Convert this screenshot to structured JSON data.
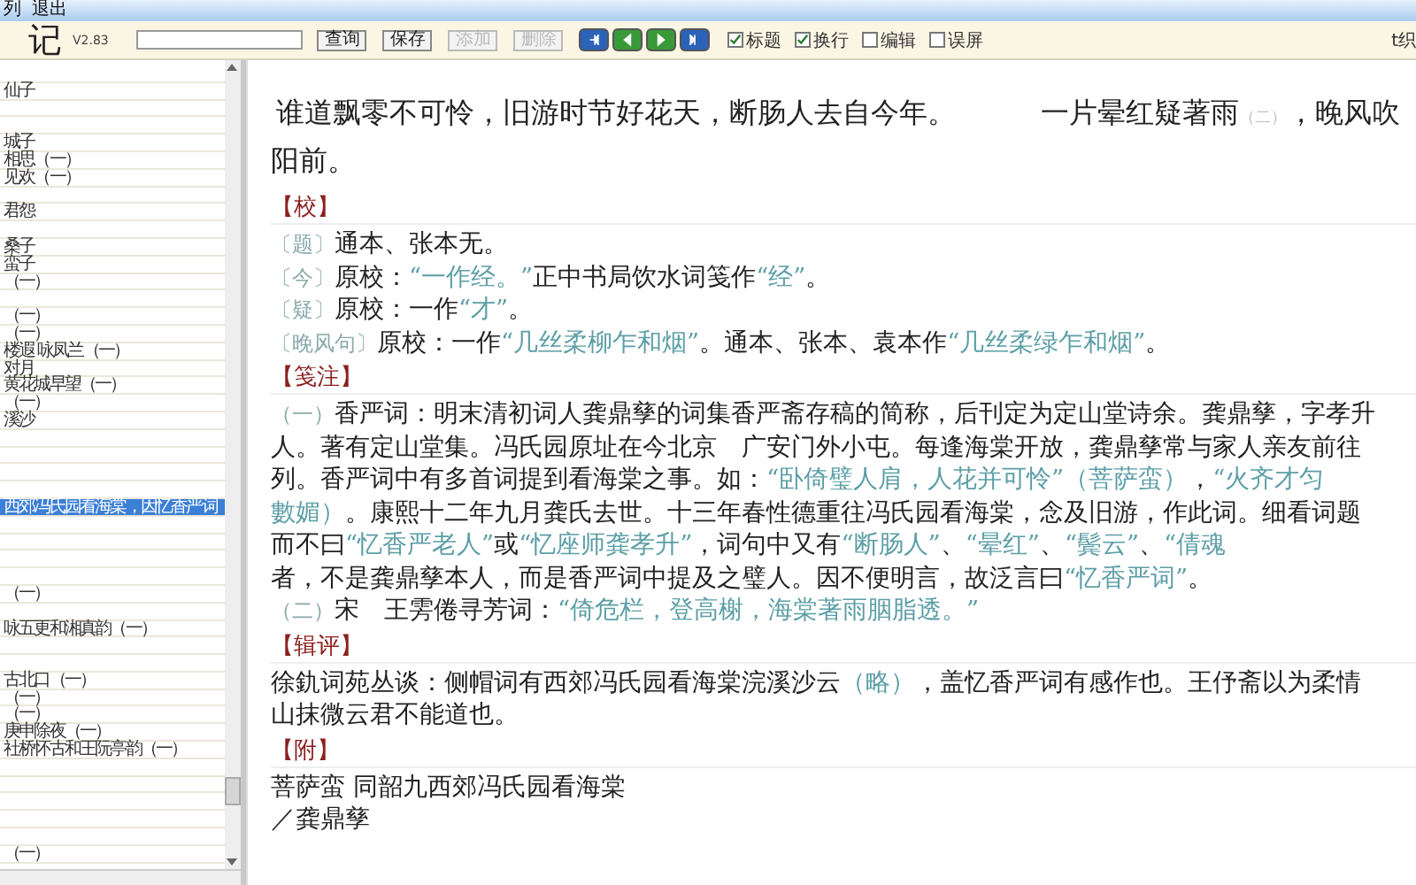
{
  "menu": [
    {
      "label": "列"
    },
    {
      "label": "退出"
    }
  ],
  "toolbar": {
    "logo": "记",
    "version": "V2.83",
    "buttons": [
      {
        "label": "查询",
        "disabled": false
      },
      {
        "label": "保存",
        "disabled": false
      },
      {
        "label": "添加",
        "disabled": true
      },
      {
        "label": "删除",
        "disabled": true
      }
    ],
    "nav_buttons": [
      {
        "kind": "first"
      },
      {
        "kind": "previous"
      },
      {
        "kind": "next"
      },
      {
        "kind": "last"
      }
    ],
    "checkboxes": [
      {
        "label": "标题",
        "checked": true
      },
      {
        "label": "换行",
        "checked": true
      },
      {
        "label": "编辑",
        "checked": false
      },
      {
        "label": "误屏",
        "checked": false
      }
    ],
    "corner_text": "t织"
  },
  "sidebar": {
    "items": [
      {
        "kind": "blank"
      },
      {
        "kind": "entry",
        "label": "仙子",
        "selected": false
      },
      {
        "kind": "blank"
      },
      {
        "kind": "blank"
      },
      {
        "kind": "entry",
        "label": "城子",
        "selected": false
      },
      {
        "kind": "entry",
        "label": "相思（一）",
        "selected": false
      },
      {
        "kind": "entry",
        "label": "见欢（一）",
        "selected": false
      },
      {
        "kind": "blank"
      },
      {
        "kind": "entry",
        "label": "君怨",
        "selected": false
      },
      {
        "kind": "blank"
      },
      {
        "kind": "entry",
        "label": "桑子",
        "selected": false
      },
      {
        "kind": "entry",
        "label": "蛮子",
        "selected": false
      },
      {
        "kind": "entry",
        "label": "（一）",
        "selected": false
      },
      {
        "kind": "blank"
      },
      {
        "kind": "entry",
        "label": "（一）",
        "selected": false
      },
      {
        "kind": "entry",
        "label": "（一）",
        "selected": false
      },
      {
        "kind": "entry",
        "label": "楼遐 咏凤兰（一）",
        "selected": false
      },
      {
        "kind": "entry",
        "label": "对月",
        "selected": false
      },
      {
        "kind": "entry",
        "label": "黄花城早望（一）",
        "selected": false
      },
      {
        "kind": "entry",
        "label": "（一）",
        "selected": false
      },
      {
        "kind": "entry",
        "label": "溪沙",
        "selected": false
      },
      {
        "kind": "blank"
      },
      {
        "kind": "blank"
      },
      {
        "kind": "blank"
      },
      {
        "kind": "blank"
      },
      {
        "kind": "entry",
        "label": "西郊冯氏园看海棠，因忆香严词",
        "selected": true
      },
      {
        "kind": "blank"
      },
      {
        "kind": "blank"
      },
      {
        "kind": "blank"
      },
      {
        "kind": "blank"
      },
      {
        "kind": "entry",
        "label": "（一）",
        "selected": false
      },
      {
        "kind": "blank"
      },
      {
        "kind": "entry",
        "label": "咏五更和湘真韵（一）",
        "selected": false
      },
      {
        "kind": "blank"
      },
      {
        "kind": "blank"
      },
      {
        "kind": "entry",
        "label": "古北口（一）",
        "selected": false
      },
      {
        "kind": "entry",
        "label": "（一）",
        "selected": false
      },
      {
        "kind": "entry",
        "label": "（一）",
        "selected": false
      },
      {
        "kind": "entry",
        "label": "庚申除夜（一）",
        "selected": false
      },
      {
        "kind": "entry",
        "label": "社桥怀古和王阮亭韵（一）",
        "selected": false
      },
      {
        "kind": "blank"
      },
      {
        "kind": "blank"
      },
      {
        "kind": "blank"
      },
      {
        "kind": "blank"
      },
      {
        "kind": "blank"
      },
      {
        "kind": "entry",
        "label": "（一）",
        "selected": false
      }
    ]
  },
  "content": {
    "poem_lines": [
      [
        {
          "kind": "text",
          "text": "谁道飘零不可怜，旧游时节好花天，断肠人去自今年。　　　一片晕红疑著雨"
        },
        {
          "kind": "note",
          "text": "（二）"
        },
        {
          "kind": "text",
          "text": "，晚风吹"
        }
      ],
      [
        {
          "kind": "text",
          "text": "阳前。"
        }
      ]
    ],
    "sections": [
      {
        "heading": "【校】",
        "lines": [
          [
            {
              "kind": "mark",
              "text": "〔题〕"
            },
            {
              "kind": "text",
              "text": "通本、张本无。"
            }
          ],
          [
            {
              "kind": "mark",
              "text": "〔今〕"
            },
            {
              "kind": "text",
              "text": "原校："
            },
            {
              "kind": "quote",
              "text": "“一作经。”"
            },
            {
              "kind": "text",
              "text": "正中书局饮水词笺作"
            },
            {
              "kind": "quote",
              "text": "“经”"
            },
            {
              "kind": "text",
              "text": "。"
            }
          ],
          [
            {
              "kind": "mark",
              "text": "〔疑〕"
            },
            {
              "kind": "text",
              "text": "原校：一作"
            },
            {
              "kind": "quote",
              "text": "“才”"
            },
            {
              "kind": "text",
              "text": "。"
            }
          ],
          [
            {
              "kind": "mark",
              "text": "〔晚风句〕"
            },
            {
              "kind": "text",
              "text": "原校：一作"
            },
            {
              "kind": "quote",
              "text": "“几丝柔柳乍和烟”"
            },
            {
              "kind": "text",
              "text": "。通本、张本、袁本作"
            },
            {
              "kind": "quote",
              "text": "“几丝柔绿乍和烟”"
            },
            {
              "kind": "text",
              "text": "。"
            }
          ]
        ]
      },
      {
        "heading": "【笺注】",
        "lines": [
          [
            {
              "kind": "mark",
              "text": "（一）"
            },
            {
              "kind": "text",
              "text": "香严词：明末清初词人龚鼎孳的词集香严斋存稿的简称，后刊定为定山堂诗余。龚鼎孳，字孝升"
            }
          ],
          [
            {
              "kind": "text",
              "text": "人。著有定山堂集。冯氏园原址在今北京　广安门外小屯。每逢海棠开放，龚鼎孳常与家人亲友前往"
            }
          ],
          [
            {
              "kind": "text",
              "text": "列。香严词中有多首词提到看海棠之事。如："
            },
            {
              "kind": "quote",
              "text": "“卧倚璧人肩，人花并可怜”"
            },
            {
              "kind": "quote",
              "text": "（菩萨蛮）"
            },
            {
              "kind": "text",
              "text": "，"
            },
            {
              "kind": "quote",
              "text": "“火齐才匀"
            }
          ],
          [
            {
              "kind": "quote",
              "text": "數媚）"
            },
            {
              "kind": "text",
              "text": "。康熙十二年九月龚氏去世。十三年春性德重往冯氏园看海棠，念及旧游，作此词。细看词题"
            }
          ],
          [
            {
              "kind": "text",
              "text": "而不曰"
            },
            {
              "kind": "quote",
              "text": "“忆香严老人”"
            },
            {
              "kind": "text",
              "text": "或"
            },
            {
              "kind": "quote",
              "text": "“忆座师龚孝升”"
            },
            {
              "kind": "text",
              "text": "，词句中又有"
            },
            {
              "kind": "quote",
              "text": "“断肠人”"
            },
            {
              "kind": "text",
              "text": "、"
            },
            {
              "kind": "quote",
              "text": "“晕红”"
            },
            {
              "kind": "text",
              "text": "、"
            },
            {
              "kind": "quote",
              "text": "“鬓云”"
            },
            {
              "kind": "text",
              "text": "、"
            },
            {
              "kind": "quote",
              "text": "“倩魂"
            }
          ],
          [
            {
              "kind": "text",
              "text": "者，不是龚鼎孳本人，而是香严词中提及之璧人。因不便明言，故泛言曰"
            },
            {
              "kind": "quote",
              "text": "“忆香严词”"
            },
            {
              "kind": "text",
              "text": "。"
            }
          ],
          [
            {
              "kind": "mark",
              "text": "（二）"
            },
            {
              "kind": "text",
              "text": "宋　王雱倦寻芳词："
            },
            {
              "kind": "quote",
              "text": "“倚危栏，登高榭，海棠著雨胭脂透。”"
            }
          ]
        ]
      },
      {
        "heading": "【辑评】",
        "lines": [
          [
            {
              "kind": "text",
              "text": "徐釚词苑丛谈：侧帽词有西郊冯氏园看海棠浣溪沙云"
            },
            {
              "kind": "quote",
              "text": "（略）"
            },
            {
              "kind": "text",
              "text": "，盖忆香严词有感作也。王伃斋以为柔情"
            }
          ],
          [
            {
              "kind": "text",
              "text": "山抹微云君不能道也。"
            }
          ]
        ]
      },
      {
        "heading": "【附】",
        "lines": [
          [
            {
              "kind": "text",
              "text": "菩萨蛮  同韶九西郊冯氏园看海棠"
            }
          ],
          [
            {
              "kind": "text",
              "text": "／龚鼎孳"
            }
          ]
        ]
      }
    ]
  }
}
